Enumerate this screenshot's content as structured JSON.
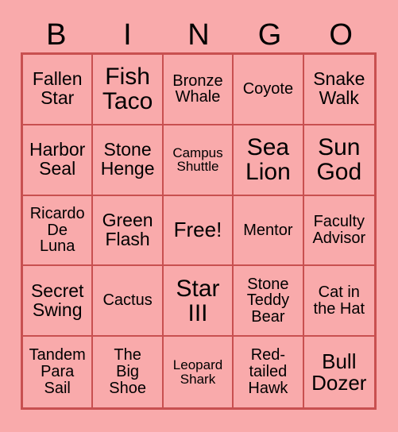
{
  "card": {
    "background_color": "#f9aaab",
    "border_color": "#c85050",
    "text_color": "#000000",
    "header": {
      "letters": [
        "B",
        "I",
        "N",
        "G",
        "O"
      ]
    },
    "grid": {
      "rows": 5,
      "columns": 5,
      "cells": [
        {
          "text": "Fallen\nStar",
          "size": "md"
        },
        {
          "text": "Fish\nTaco",
          "size": "xl"
        },
        {
          "text": "Bronze\nWhale",
          "size": "sm"
        },
        {
          "text": "Coyote",
          "size": "sm"
        },
        {
          "text": "Snake\nWalk",
          "size": "md"
        },
        {
          "text": "Harbor\nSeal",
          "size": "md"
        },
        {
          "text": "Stone\nHenge",
          "size": "md"
        },
        {
          "text": "Campus\nShuttle",
          "size": "xs"
        },
        {
          "text": "Sea\nLion",
          "size": "xl"
        },
        {
          "text": "Sun\nGod",
          "size": "xl"
        },
        {
          "text": "Ricardo\nDe\nLuna",
          "size": "sm"
        },
        {
          "text": "Green\nFlash",
          "size": "md"
        },
        {
          "text": "Free!",
          "size": "lg"
        },
        {
          "text": "Mentor",
          "size": "sm"
        },
        {
          "text": "Faculty\nAdvisor",
          "size": "sm"
        },
        {
          "text": "Secret\nSwing",
          "size": "md"
        },
        {
          "text": "Cactus",
          "size": "sm"
        },
        {
          "text": "Star\nIII",
          "size": "xl"
        },
        {
          "text": "Stone\nTeddy\nBear",
          "size": "sm"
        },
        {
          "text": "Cat in\nthe Hat",
          "size": "sm"
        },
        {
          "text": "Tandem\nPara\nSail",
          "size": "sm"
        },
        {
          "text": "The\nBig\nShoe",
          "size": "sm"
        },
        {
          "text": "Leopard\nShark",
          "size": "xs"
        },
        {
          "text": "Red-\ntailed\nHawk",
          "size": "sm"
        },
        {
          "text": "Bull\nDozer",
          "size": "lg"
        }
      ]
    }
  }
}
